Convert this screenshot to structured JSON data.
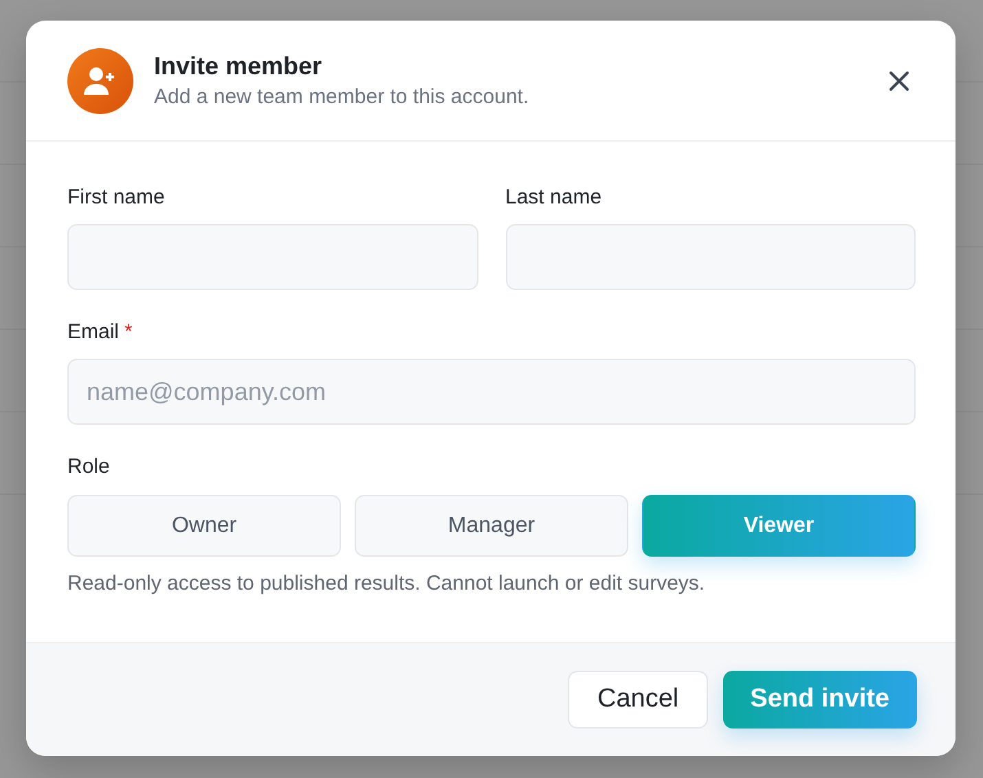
{
  "dialog": {
    "title": "Invite member",
    "subtitle": "Add a new team member to this account.",
    "fields": [
      {
        "label": "First name"
      },
      {
        "label": "Last name"
      },
      {
        "label": "Email",
        "required_mark": "*",
        "placeholder": "name@company.com"
      }
    ],
    "role": {
      "label": "Role",
      "options": [
        {
          "label": "Owner",
          "selected": false
        },
        {
          "label": "Manager",
          "selected": false
        },
        {
          "label": "Viewer",
          "selected": true
        }
      ],
      "description": "Read-only access to published results. Cannot launch or edit surveys."
    },
    "buttons": [
      {
        "label": "Cancel",
        "kind": "secondary"
      },
      {
        "label": "Send invite",
        "kind": "primary"
      }
    ]
  }
}
